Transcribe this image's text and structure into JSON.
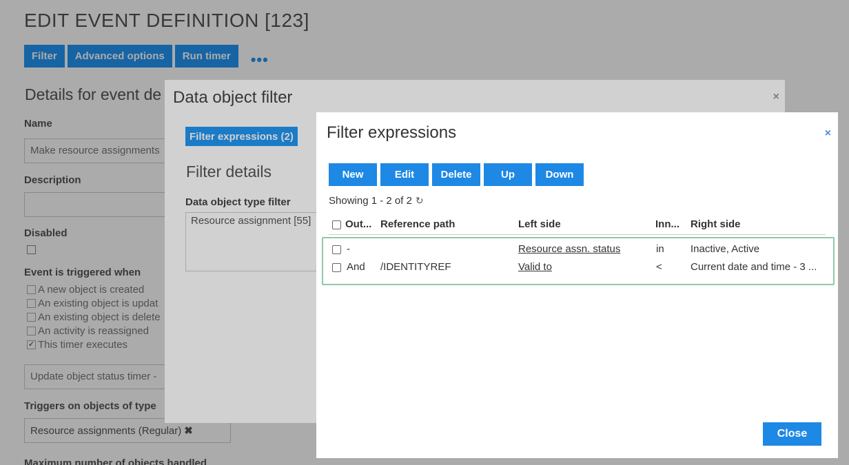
{
  "page": {
    "title": "EDIT EVENT DEFINITION [123]",
    "toolbar": [
      "Filter",
      "Advanced options",
      "Run timer"
    ],
    "toolbar_more": "•••",
    "section_title": "Details for event de",
    "name_label": "Name",
    "name_value": "Make resource assignments",
    "description_label": "Description",
    "disabled_label": "Disabled",
    "triggered_label": "Event is triggered when",
    "triggers": [
      {
        "label": "A new object is created",
        "checked": false
      },
      {
        "label": "An existing object is updat",
        "checked": false
      },
      {
        "label": "An existing object is delete",
        "checked": false
      },
      {
        "label": "An activity is reassigned",
        "checked": false
      },
      {
        "label": "This timer executes",
        "checked": true
      }
    ],
    "timer_value": "Update object status timer -",
    "types_label": "Triggers on objects of type",
    "types_value": "Resource assignments (Regular)",
    "tag_remove": "✖",
    "max_label": "Maximum number of objects handled"
  },
  "modal1": {
    "title": "Data object filter",
    "close": "×",
    "tab": "Filter expressions (2)",
    "section": "Filter details",
    "type_label": "Data object type filter",
    "type_value": "Resource assignment [55]"
  },
  "modal2": {
    "title": "Filter expressions",
    "close": "×",
    "buttons": [
      "New",
      "Edit",
      "Delete",
      "Up",
      "Down"
    ],
    "showing": "Showing 1 - 2 of 2",
    "refresh_icon": "↻",
    "columns": [
      "Out...",
      "Reference path",
      "Left side",
      "Inn...",
      "Right side"
    ],
    "rows": [
      {
        "op": "-",
        "ref": "",
        "left": "Resource assn. status",
        "inner": "in",
        "right": "Inactive, Active"
      },
      {
        "op": "And",
        "ref": "/IDENTITYREF",
        "left": "Valid to",
        "inner": "<",
        "right": "Current date and time - 3 ..."
      }
    ],
    "close_button": "Close"
  }
}
